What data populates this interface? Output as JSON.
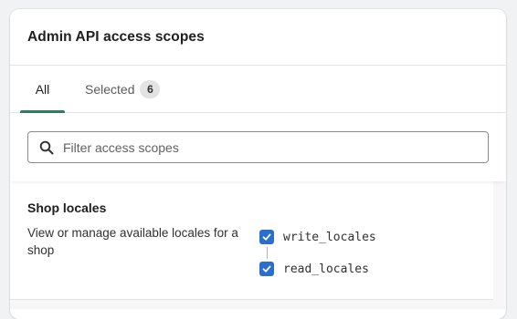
{
  "card": {
    "title": "Admin API access scopes"
  },
  "tabs": [
    {
      "label": "All",
      "active": true
    },
    {
      "label": "Selected",
      "count": "6",
      "active": false
    }
  ],
  "search": {
    "placeholder": "Filter access scopes",
    "value": "",
    "icon": "search-icon"
  },
  "scope_groups": [
    {
      "title": "Shop locales",
      "description": "View or manage available locales for a shop",
      "scopes": [
        {
          "name": "write_locales",
          "checked": true
        },
        {
          "name": "read_locales",
          "checked": true
        }
      ]
    }
  ],
  "colors": {
    "accent_tab": "#2e7d5b",
    "checkbox": "#2c6ecb"
  }
}
